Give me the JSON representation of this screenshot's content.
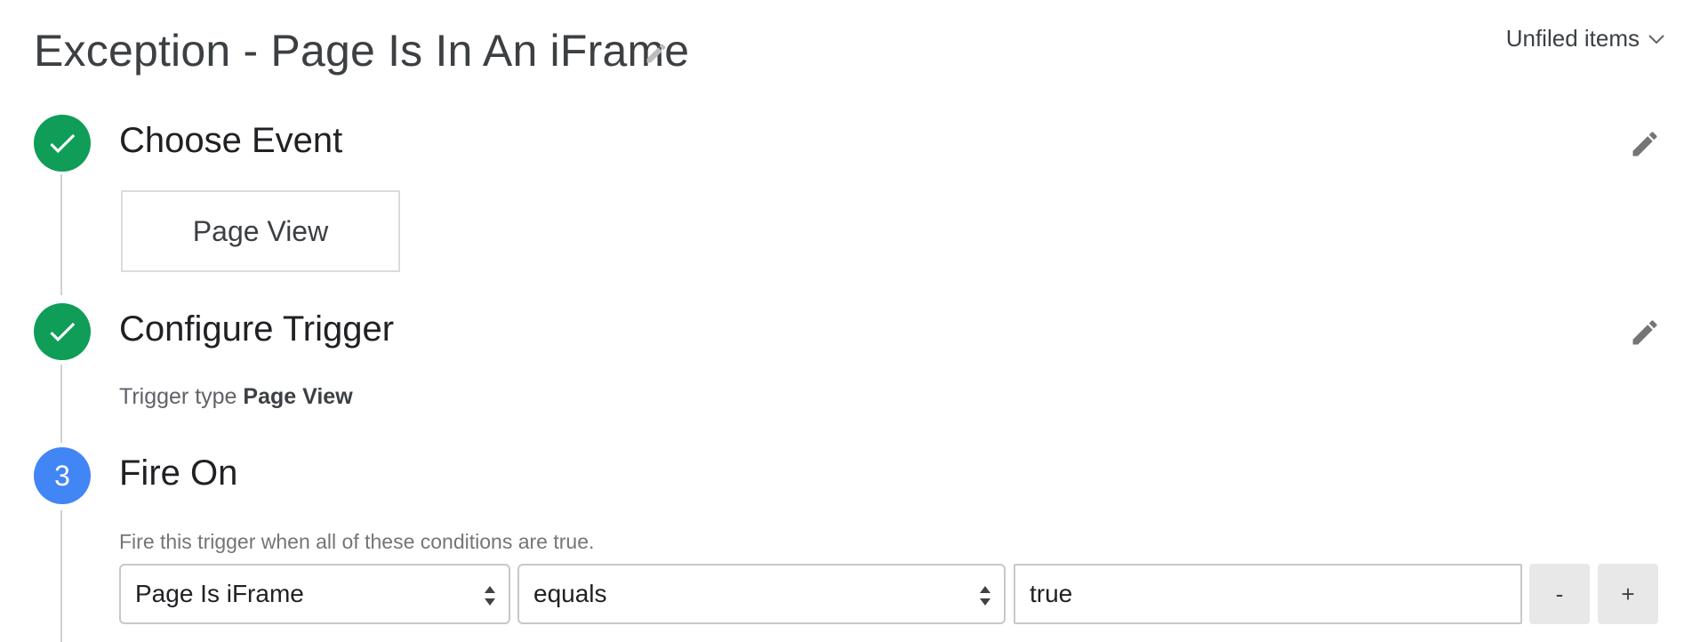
{
  "header": {
    "title": "Exception - Page Is In An iFrame",
    "folder_label": "Unfiled items"
  },
  "steps": [
    {
      "number": "1",
      "title": "Choose Event",
      "status": "done",
      "event_card": "Page View"
    },
    {
      "number": "2",
      "title": "Configure Trigger",
      "status": "done",
      "trigger_type_label": "Trigger type",
      "trigger_type_value": "Page View"
    },
    {
      "number": "3",
      "title": "Fire On",
      "status": "active",
      "hint": "Fire this trigger when all of these conditions are true."
    }
  ],
  "condition": {
    "variable": "Page Is iFrame",
    "operator": "equals",
    "value": "true",
    "remove_label": "-",
    "add_label": "+"
  },
  "colors": {
    "done": "#0f9d58",
    "active": "#4285f4"
  }
}
